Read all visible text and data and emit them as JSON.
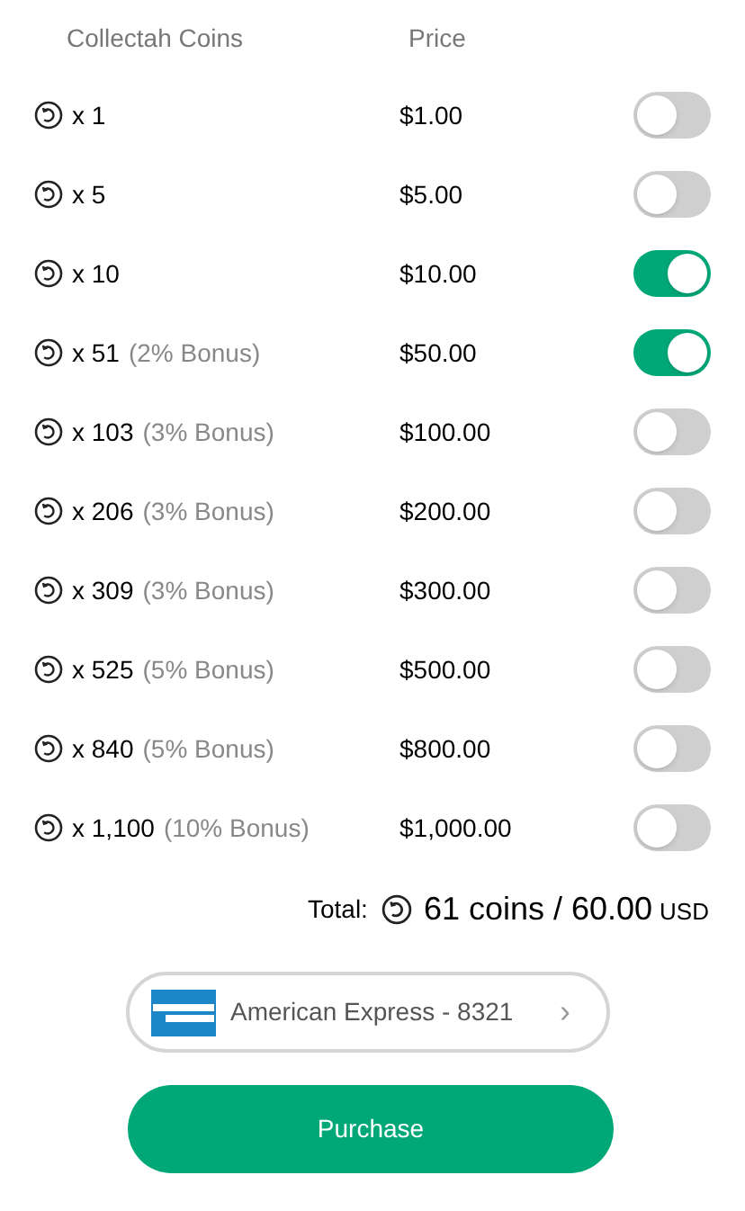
{
  "header": {
    "coins": "Collectah Coins",
    "price": "Price"
  },
  "bundles": [
    {
      "amount": "x 1",
      "price": "$1.00",
      "on": false
    },
    {
      "amount": "x 5",
      "price": "$5.00",
      "on": false
    },
    {
      "amount": "x 10",
      "price": "$10.00",
      "on": true
    },
    {
      "amount": "x 51",
      "bonus": "(2% Bonus)",
      "price": "$50.00",
      "on": true
    },
    {
      "amount": "x 103",
      "bonus": "(3% Bonus)",
      "price": "$100.00",
      "on": false
    },
    {
      "amount": "x 206",
      "bonus": "(3% Bonus)",
      "price": "$200.00",
      "on": false
    },
    {
      "amount": "x 309",
      "bonus": "(3% Bonus)",
      "price": "$300.00",
      "on": false
    },
    {
      "amount": "x 525",
      "bonus": "(5% Bonus)",
      "price": "$500.00",
      "on": false
    },
    {
      "amount": "x 840",
      "bonus": "(5% Bonus)",
      "price": "$800.00",
      "on": false
    },
    {
      "amount": "x 1,100",
      "bonus": "(10% Bonus)",
      "price": "$1,000.00",
      "on": false
    }
  ],
  "total": {
    "label": "Total:",
    "value": "61 coins / 60.00",
    "currency": "USD"
  },
  "payment": {
    "label": "American Express - 8321",
    "chevron": "›"
  },
  "purchase_button": "Purchase"
}
